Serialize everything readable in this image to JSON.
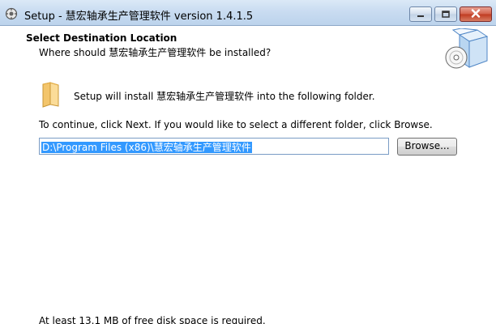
{
  "window": {
    "title": "Setup - 慧宏轴承生产管理软件 version 1.4.1.5",
    "app_icon": "setup-icon",
    "controls": {
      "minimize_icon": "minimize-icon",
      "maximize_icon": "maximize-icon",
      "close_icon": "close-icon"
    }
  },
  "header": {
    "title": "Select Destination Location",
    "subtitle": "Where should 慧宏轴承生产管理软件 be installed?",
    "graphic": "setup-box-cd-icon"
  },
  "content": {
    "folder_icon": "folder-icon",
    "install_text": "Setup will install 慧宏轴承生产管理软件 into the following folder.",
    "instruction": "To continue, click Next. If you would like to select a different folder, click Browse.",
    "destination_path": "D:\\Program Files (x86)\\慧宏轴承生产管理软件",
    "browse_label": "Browse...",
    "disk_space": "At least 13.1 MB of free disk space is required."
  },
  "colors": {
    "titlebar": "#c9dcf1",
    "selection": "#3399ff",
    "close_button": "#c0391f"
  }
}
